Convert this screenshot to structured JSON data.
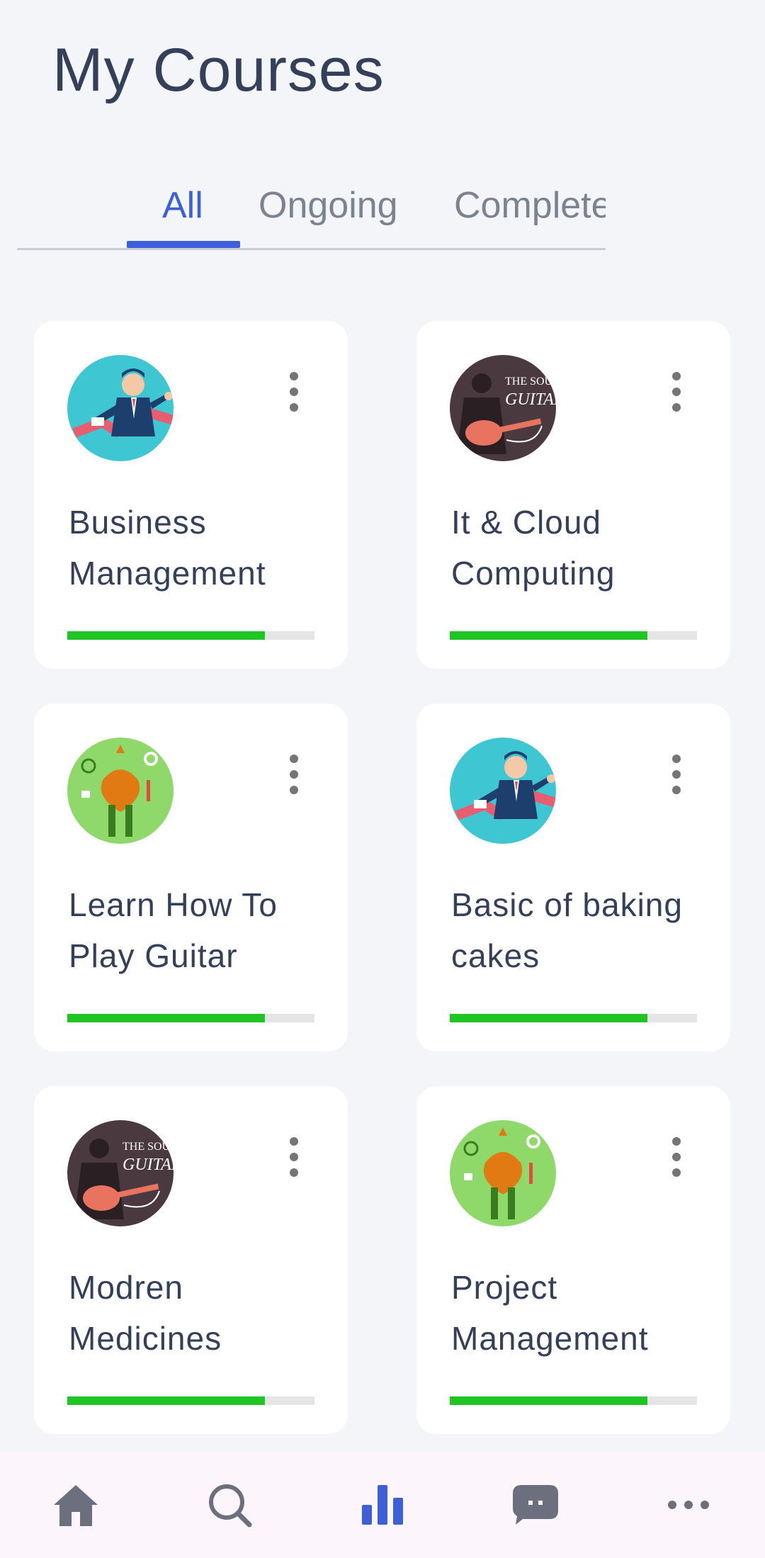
{
  "page": {
    "title": "My Courses"
  },
  "tabs": [
    {
      "label": "All",
      "active": true
    },
    {
      "label": "Ongoing",
      "active": false
    },
    {
      "label": "Completed",
      "active": false
    }
  ],
  "courses": [
    {
      "title": "Business Management",
      "image": "businessman-illustration",
      "progress": 0.8
    },
    {
      "title": "It & Cloud Computing",
      "image": "guitar-illustration",
      "progress": 0.8
    },
    {
      "title": "Learn How To Play Guitar",
      "image": "medicine-illustration",
      "progress": 0.8
    },
    {
      "title": "Basic of baking cakes",
      "image": "businessman-illustration",
      "progress": 0.8
    },
    {
      "title": "Modren Medicines",
      "image": "guitar-illustration",
      "progress": 0.8
    },
    {
      "title": "Project Management",
      "image": "medicine-illustration",
      "progress": 0.8
    }
  ],
  "bottom_nav": [
    {
      "icon": "home-icon",
      "active": false
    },
    {
      "icon": "search-icon",
      "active": false
    },
    {
      "icon": "bar-chart-icon",
      "active": true
    },
    {
      "icon": "chat-icon",
      "active": false
    },
    {
      "icon": "more-horizontal-icon",
      "active": false
    }
  ],
  "colors": {
    "accent": "#3d5fd9",
    "progress": "#1fc623",
    "text": "#34405a",
    "inactive_icon": "#6b6f7e"
  }
}
